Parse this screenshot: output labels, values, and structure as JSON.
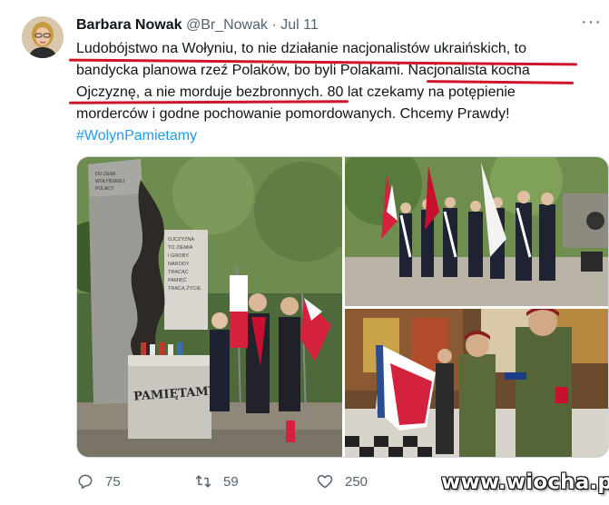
{
  "tweet": {
    "author_name": "Barbara Nowak",
    "handle": "@Br_Nowak",
    "separator": "·",
    "date": "Jul 11",
    "lines": [
      "Ludobójstwo na Wołyniu, to nie działanie nacjonalistów ukraińskich, to",
      "bandycka planowa rzeź Polaków, bo byli Polakami. Nacjonalista kocha",
      "Ojczyznę, a nie morduje bezbronnych. 80 lat czekamy na potępienie",
      "morderców i godne pochowanie pomordowanych. Chcemy Prawdy!"
    ],
    "hashtag": "#WolynPamietamy"
  },
  "monument": {
    "plaque_right": [
      "OJCZYZNA",
      "TO ZIEMIA",
      "I GROBY.",
      "NARODY",
      "TRACĄC",
      "PAMIĘĆ",
      "TRACĄ ŻYCIE"
    ],
    "plaque_left": [
      "DO ZIEMI",
      "WOŁYŃSKIEJ",
      "POLACY"
    ],
    "base_text": "PAMIĘTAMY"
  },
  "actions": {
    "replies": "75",
    "retweets": "59",
    "likes": "250"
  },
  "watermark": "www.wiocha.pl",
  "colors": {
    "underline": "#d0152a",
    "hashtag": "#1d9bf0",
    "secondary_text": "#536471"
  }
}
